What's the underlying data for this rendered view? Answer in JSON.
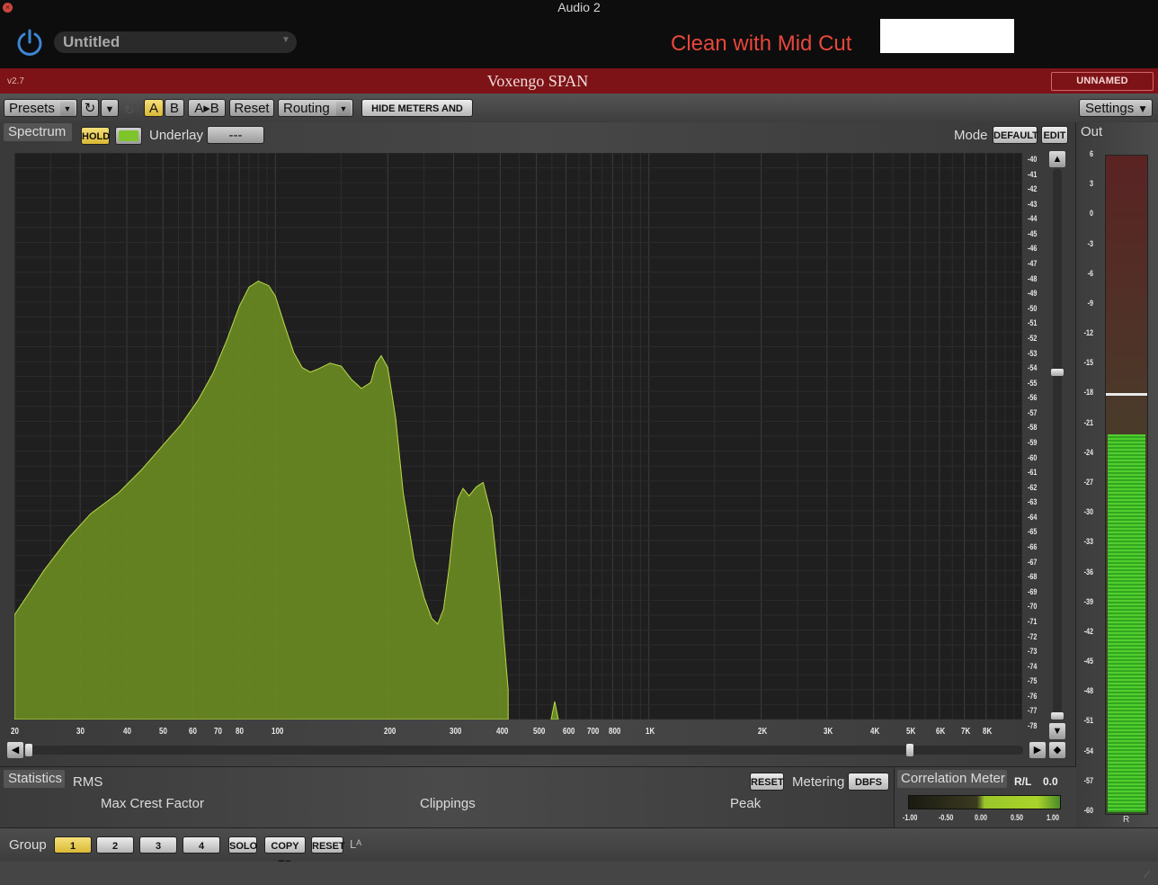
{
  "host": {
    "window_title": "Audio 2",
    "preset_name": "Untitled",
    "overlay_text": "Clean with Mid Cut"
  },
  "plugin": {
    "version": "v2.7",
    "name": "Voxengo SPAN",
    "instance_label": "UNNAMED INSTANCE"
  },
  "toolbar": {
    "presets": "Presets",
    "a": "A",
    "b": "B",
    "ab": "A▸B",
    "reset": "Reset",
    "routing": "Routing",
    "hide_meters": "HIDE METERS AND STATS",
    "settings": "Settings"
  },
  "spectrum": {
    "label": "Spectrum",
    "hold": "HOLD",
    "underlay_label": "Underlay",
    "underlay_value": "---",
    "mode_label": "Mode",
    "mode_default": "DEFAULT",
    "mode_edit": "EDIT"
  },
  "out_meter": {
    "label": "Out",
    "channel": "R",
    "scale": [
      "6",
      "3",
      "0",
      "-3",
      "-6",
      "-9",
      "-12",
      "-15",
      "-18",
      "-21",
      "-24",
      "-27",
      "-30",
      "-33",
      "-36",
      "-39",
      "-42",
      "-45",
      "-48",
      "-51",
      "-54",
      "-57",
      "-60"
    ],
    "level_db": -22,
    "peak_db": -18
  },
  "chart_data": {
    "type": "area",
    "x_scale": "log",
    "xlim": [
      20,
      10000
    ],
    "ylim": [
      -78,
      -40
    ],
    "x_ticks": [
      {
        "v": 20,
        "t": "20"
      },
      {
        "v": 30,
        "t": "30"
      },
      {
        "v": 40,
        "t": "40"
      },
      {
        "v": 50,
        "t": "50"
      },
      {
        "v": 60,
        "t": "60"
      },
      {
        "v": 70,
        "t": "70"
      },
      {
        "v": 80,
        "t": "80"
      },
      {
        "v": 100,
        "t": "100"
      },
      {
        "v": 200,
        "t": "200"
      },
      {
        "v": 300,
        "t": "300"
      },
      {
        "v": 400,
        "t": "400"
      },
      {
        "v": 500,
        "t": "500"
      },
      {
        "v": 600,
        "t": "600"
      },
      {
        "v": 700,
        "t": "700"
      },
      {
        "v": 800,
        "t": "800"
      },
      {
        "v": 1000,
        "t": "1K"
      },
      {
        "v": 2000,
        "t": "2K"
      },
      {
        "v": 3000,
        "t": "3K"
      },
      {
        "v": 4000,
        "t": "4K"
      },
      {
        "v": 5000,
        "t": "5K"
      },
      {
        "v": 6000,
        "t": "6K"
      },
      {
        "v": 7000,
        "t": "7K"
      },
      {
        "v": 8000,
        "t": "8K"
      }
    ],
    "y_ticks": [
      -40,
      -41,
      -42,
      -43,
      -44,
      -45,
      -46,
      -47,
      -48,
      -49,
      -50,
      -51,
      -52,
      -53,
      -54,
      -55,
      -56,
      -57,
      -58,
      -59,
      -60,
      -61,
      -62,
      -63,
      -64,
      -65,
      -66,
      -67,
      -68,
      -69,
      -70,
      -71,
      -72,
      -73,
      -74,
      -75,
      -76,
      -77,
      -78
    ],
    "series": [
      {
        "x": [
          20,
          24,
          28,
          32,
          38,
          44,
          50,
          56,
          62,
          68,
          74,
          80,
          85,
          90,
          96,
          100,
          106,
          112,
          118,
          124,
          130,
          140,
          150,
          160,
          170,
          180,
          186,
          192,
          200,
          210,
          220,
          235,
          250,
          262,
          272,
          282,
          292,
          300,
          308,
          318,
          330,
          345,
          360,
          380,
          400,
          420
        ],
        "y": [
          -71.0,
          -68.0,
          -65.8,
          -64.2,
          -62.8,
          -61.2,
          -59.6,
          -58.2,
          -56.6,
          -54.8,
          -52.6,
          -50.3,
          -49.0,
          -48.6,
          -48.9,
          -49.6,
          -51.6,
          -53.4,
          -54.4,
          -54.7,
          -54.5,
          -54.1,
          -54.3,
          -55.2,
          -55.8,
          -55.4,
          -54.1,
          -53.6,
          -54.4,
          -57.8,
          -62.8,
          -67.2,
          -69.8,
          -71.2,
          -71.6,
          -70.6,
          -67.8,
          -65.0,
          -63.2,
          -62.5,
          -63.0,
          -62.4,
          -62.1,
          -64.4,
          -69.6,
          -76.0
        ]
      }
    ]
  },
  "stats": {
    "label": "Statistics",
    "rms": "RMS",
    "max_crest": "Max Crest Factor",
    "clippings": "Clippings",
    "peak": "Peak",
    "reset": "RESET",
    "metering_label": "Metering",
    "metering_value": "DBFS"
  },
  "correlation": {
    "label": "Correlation Meter",
    "rl": "R/L",
    "value": "0.0",
    "scale": [
      "-1.00",
      "-0.50",
      "0.00",
      "0.50",
      "1.00"
    ]
  },
  "group": {
    "label": "Group",
    "buttons": [
      "1",
      "2",
      "3",
      "4"
    ],
    "solo": "SOLO",
    "copy_to": "COPY TO",
    "reset": "RESET",
    "la": "Lᴬ"
  },
  "colors": {
    "spectrum_fill": "#6a8a23",
    "spectrum_line": "#b9d94a",
    "accent_red": "#7d1316",
    "overlay_red": "#e8473b",
    "yellow_btn": "#e6c84c"
  }
}
